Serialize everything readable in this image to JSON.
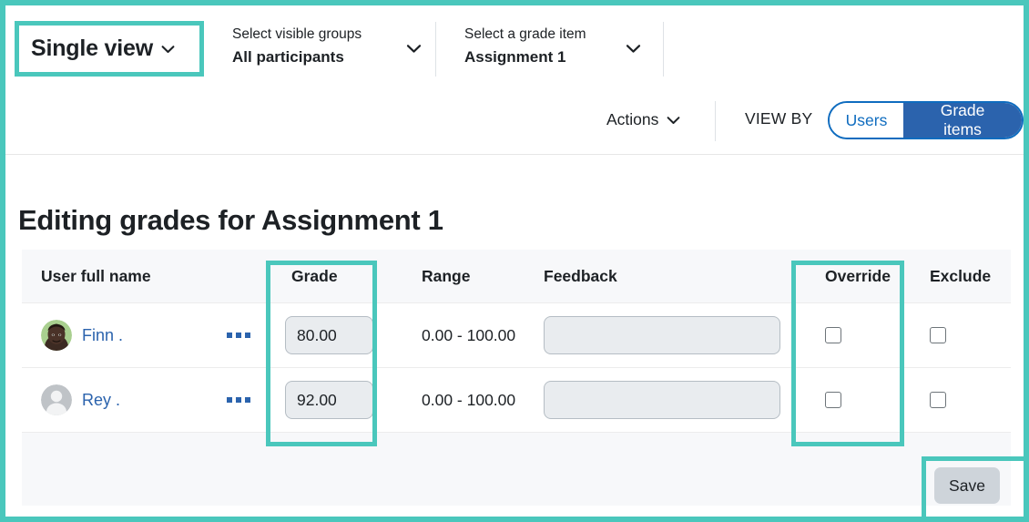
{
  "toolbar": {
    "single_view_label": "Single view",
    "single_view_chevron": "chevron-down-icon",
    "selectors": [
      {
        "caption": "Select visible groups",
        "value": "All participants",
        "chevron": "chevron-down-icon"
      },
      {
        "caption": "Select a grade item",
        "value": "Assignment 1",
        "chevron": "chevron-down-icon"
      }
    ],
    "actions_label": "Actions",
    "actions_chevron": "chevron-down-icon",
    "view_by_label": "VIEW BY",
    "view_by_options": [
      {
        "label": "Users",
        "selected": false
      },
      {
        "label": "Grade items",
        "selected": true
      }
    ]
  },
  "page": {
    "heading": "Editing grades for Assignment 1"
  },
  "table": {
    "columns": [
      "User full name",
      "Grade",
      "Range",
      "Feedback",
      "Override",
      "Exclude"
    ],
    "rows": [
      {
        "avatar": "user-photo-avatar",
        "name": "Finn .",
        "kebab": "ellipsis-menu-icon",
        "grade": "80.00",
        "range": "0.00 - 100.00",
        "feedback": "",
        "feedback_placeholder": "",
        "override": false,
        "exclude": false
      },
      {
        "avatar": "user-placeholder-avatar",
        "name": "Rey .",
        "kebab": "ellipsis-menu-icon",
        "grade": "92.00",
        "range": "0.00 - 100.00",
        "feedback": "",
        "feedback_placeholder": "",
        "override": false,
        "exclude": false
      }
    ]
  },
  "footer": {
    "save_label": "Save"
  },
  "colors": {
    "annotation_teal": "#4ac7bc",
    "link_blue": "#2b63ad",
    "primary_blue": "#0f6cbf",
    "selected_fill": "#2b63ad",
    "input_fill": "#e9ecef",
    "table_header_bg": "#f7f8fa",
    "save_button_bg": "#ced4da"
  }
}
